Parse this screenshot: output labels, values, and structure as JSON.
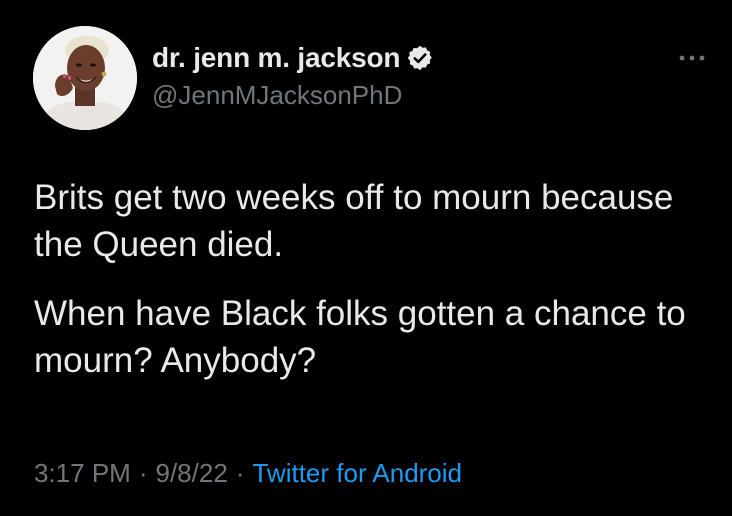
{
  "author": {
    "display_name": "dr. jenn m. jackson",
    "handle": "@JennMJacksonPhD",
    "verified": true,
    "avatar_icon": "profile-photo"
  },
  "tweet": {
    "paragraphs": [
      "Brits get two weeks off to mourn because the Queen died.",
      "When have Black folks gotten a chance to mourn? Anybody?"
    ],
    "time": "3:17 PM",
    "date": "9/8/22",
    "separator": "·",
    "source": "Twitter for Android"
  },
  "colors": {
    "background": "#000000",
    "text": "#e7e9ea",
    "secondary": "#71767b",
    "link": "#1d9bf0"
  },
  "icons": {
    "verified": "verified-badge-icon",
    "more": "more-options-icon"
  }
}
